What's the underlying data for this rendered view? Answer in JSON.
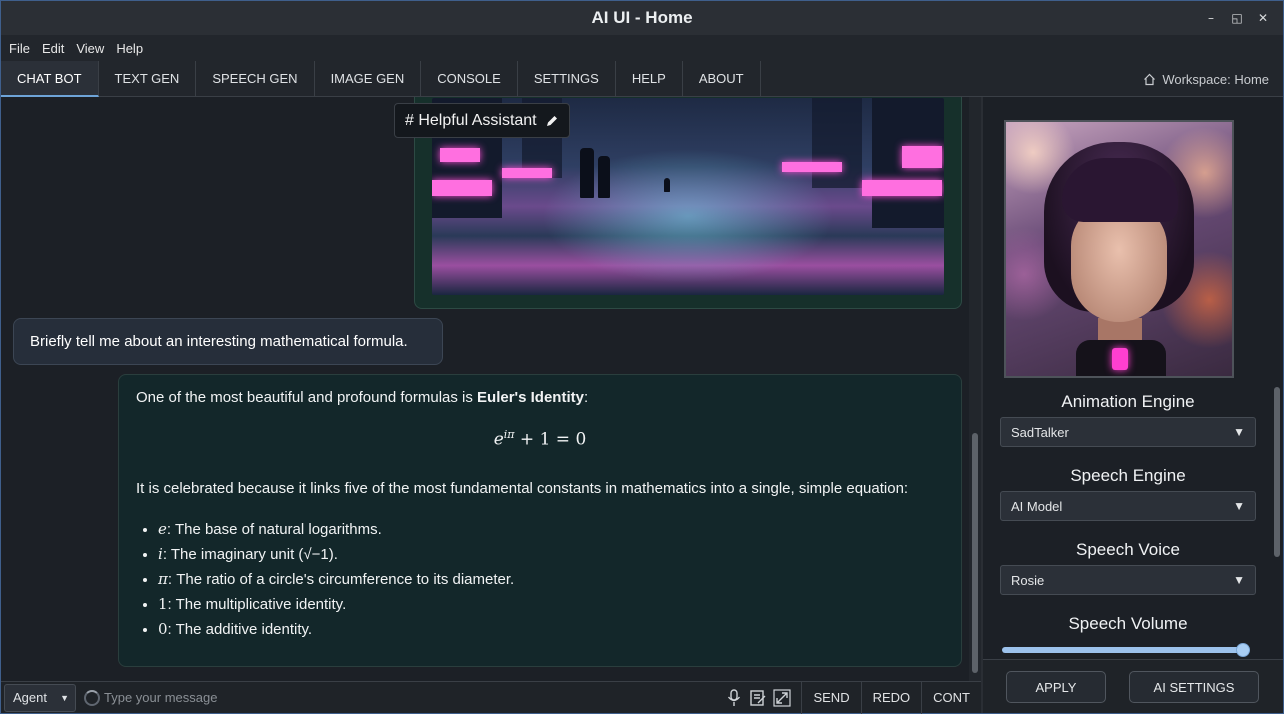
{
  "window": {
    "title": "AI UI - Home",
    "buttons": [
      "–",
      "◱",
      "✕"
    ]
  },
  "menu": [
    "File",
    "Edit",
    "View",
    "Help"
  ],
  "tabs": [
    "CHAT BOT",
    "TEXT GEN",
    "SPEECH GEN",
    "IMAGE GEN",
    "CONSOLE",
    "SETTINGS",
    "HELP",
    "ABOUT"
  ],
  "active_tab": "CHAT BOT",
  "workspace": {
    "icon": "home-icon",
    "label": "Workspace: Home"
  },
  "chat": {
    "persona": "# Helpful Assistant",
    "persona_icon": "pencil-icon",
    "image_message": {
      "description_icon": "neon-city-image"
    },
    "user_message": "Briefly tell me about an interesting mathematical formula.",
    "bot_message": {
      "intro_prefix": "One of the most beautiful and profound formulas is ",
      "intro_bold": "Euler's Identity",
      "intro_suffix": ":",
      "formula_base": "e",
      "formula_exp": "iπ",
      "formula_rest": " + 1 = 0",
      "celebrated": "It is celebrated because it links five of the most fundamental constants in mathematics into a single, simple equation:",
      "items": [
        {
          "sym": "e",
          "text": ": The base of natural logarithms."
        },
        {
          "sym": "i",
          "text": ": The imaginary unit (√−1)."
        },
        {
          "sym": "π",
          "text": ": The ratio of a circle's circumference to its diameter."
        },
        {
          "sym": "1",
          "text": ": The multiplicative identity."
        },
        {
          "sym": "0",
          "text": ": The additive identity."
        }
      ]
    }
  },
  "input": {
    "mode": "Agent",
    "placeholder": "Type your message",
    "icons": [
      "microphone-icon",
      "edit-note-icon",
      "expand-icon"
    ],
    "buttons": {
      "send": "SEND",
      "redo": "REDO",
      "cont": "CONT"
    }
  },
  "right_panel": {
    "avatar_icon": "avatar-portrait",
    "animation_engine": {
      "label": "Animation Engine",
      "value": "SadTalker"
    },
    "speech_engine": {
      "label": "Speech Engine",
      "value": "AI Model"
    },
    "speech_voice": {
      "label": "Speech Voice",
      "value": "Rosie"
    },
    "speech_volume": {
      "label": "Speech Volume",
      "value": 0.97
    },
    "apply": "APPLY",
    "ai_settings": "AI SETTINGS"
  },
  "colors": {
    "accent": "#6ea4d8",
    "bot_bg": "#13272a",
    "user_bg": "#262e3a",
    "slider": "#9cc2ec"
  }
}
